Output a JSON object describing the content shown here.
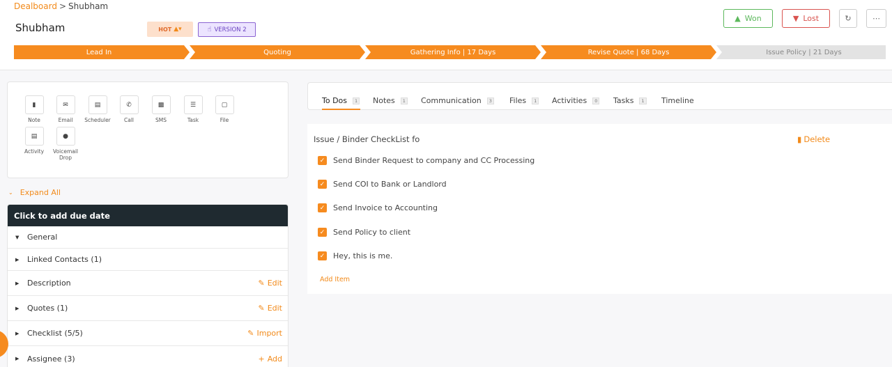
{
  "breadcrumb": {
    "root": "Dealboard",
    "separator": ">",
    "current": "Shubham"
  },
  "title": "Shubham",
  "badges": {
    "hot": "HOT",
    "hot_icon": "flame-icon",
    "version": "VERSION 2",
    "version_icon": "hand-pointer-icon"
  },
  "buttons": {
    "won": "Won",
    "lost": "Lost"
  },
  "pipeline": [
    {
      "label": "Lead In",
      "status": "done"
    },
    {
      "label": "Quoting",
      "status": "done"
    },
    {
      "label": "Gathering Info | 17 Days",
      "status": "done"
    },
    {
      "label": "Revise Quote | 68 Days",
      "status": "done"
    },
    {
      "label": "Issue Policy | 21 Days",
      "status": "todo"
    }
  ],
  "actions": [
    {
      "label": "Note",
      "icon": "note-icon"
    },
    {
      "label": "Email",
      "icon": "email-icon"
    },
    {
      "label": "Scheduler",
      "icon": "calendar-icon"
    },
    {
      "label": "Call",
      "icon": "phone-icon"
    },
    {
      "label": "SMS",
      "icon": "sms-icon"
    },
    {
      "label": "Task",
      "icon": "task-icon"
    },
    {
      "label": "File",
      "icon": "folder-icon"
    },
    {
      "label": "Activity",
      "icon": "calendar-icon"
    },
    {
      "label": "Voicemail Drop",
      "icon": "microphone-icon"
    }
  ],
  "expand_all": "Expand All",
  "accordion": {
    "header": "Click to add due date",
    "rows": [
      {
        "label": "General",
        "expanded": true,
        "action": ""
      },
      {
        "label": "Linked Contacts (1)",
        "expanded": false,
        "action": ""
      },
      {
        "label": "Description",
        "expanded": false,
        "action": "Edit"
      },
      {
        "label": "Quotes (1)",
        "expanded": false,
        "action": "Edit"
      },
      {
        "label": "Checklist (5/5)",
        "expanded": false,
        "action": "Import"
      },
      {
        "label": "Assignee (3)",
        "expanded": false,
        "action": "Add"
      }
    ]
  },
  "tabs": [
    {
      "label": "To Dos",
      "count": "1"
    },
    {
      "label": "Notes",
      "count": "1"
    },
    {
      "label": "Communication",
      "count": "3"
    },
    {
      "label": "Files",
      "count": "1"
    },
    {
      "label": "Activities",
      "count": "0"
    },
    {
      "label": "Tasks",
      "count": "1"
    },
    {
      "label": "Timeline",
      "count": ""
    }
  ],
  "checklist": {
    "title": "Issue / Binder CheckList fo",
    "delete_label": "Delete",
    "items": [
      "Send Binder Request to company and CC Processing",
      "Send COI to Bank or Landlord",
      "Send Invoice to Accounting",
      "Send Policy to client",
      "Hey, this is me."
    ],
    "add_item": "Add Item"
  },
  "colors": {
    "accent": "#f68b1f",
    "won": "#5cb85c",
    "lost": "#d9534f",
    "dark_header": "#1f2a30"
  }
}
